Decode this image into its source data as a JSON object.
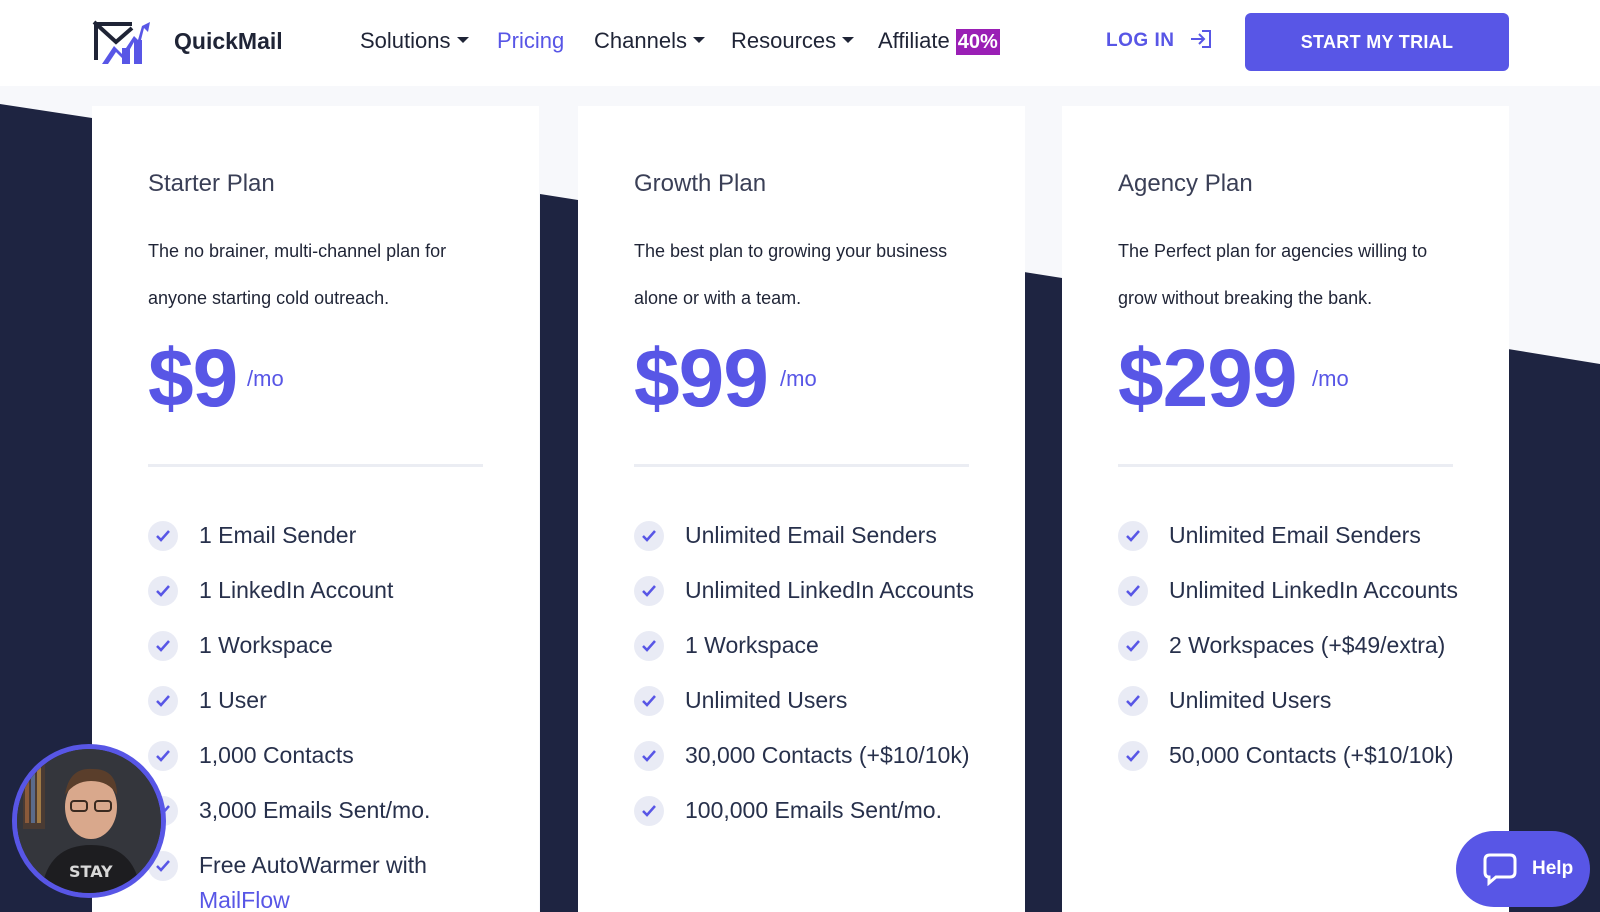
{
  "header": {
    "brand": "QuickMail",
    "nav": [
      {
        "label": "Solutions",
        "dropdown": true
      },
      {
        "label": "Pricing",
        "dropdown": false,
        "active": true
      },
      {
        "label": "Channels",
        "dropdown": true
      },
      {
        "label": "Resources",
        "dropdown": true
      },
      {
        "label": "Affiliate",
        "dropdown": false,
        "badge": "40%"
      }
    ],
    "login_label": "LOG IN",
    "trial_label": "START MY TRIAL"
  },
  "plans": [
    {
      "name": "Starter Plan",
      "description": "The no brainer, multi-channel plan for anyone starting cold outreach.",
      "price": "$9",
      "unit": "/mo",
      "features": [
        "1 Email Sender",
        "1 LinkedIn Account",
        "1 Workspace",
        "1 User",
        "1,000 Contacts",
        "3,000 Emails Sent/mo.",
        "Free AutoWarmer with"
      ],
      "feature_link": "MailFlow"
    },
    {
      "name": "Growth Plan",
      "description": "The best plan to growing your business alone or with a team.",
      "price": "$99",
      "unit": "/mo",
      "features": [
        "Unlimited Email Senders",
        "Unlimited LinkedIn Accounts",
        "1 Workspace",
        "Unlimited Users",
        "30,000 Contacts (+$10/10k)",
        "100,000 Emails Sent/mo."
      ]
    },
    {
      "name": "Agency Plan",
      "description": "The Perfect plan for agencies willing to grow without breaking the bank.",
      "price": "$299",
      "unit": "/mo",
      "features": [
        "Unlimited Email Senders",
        "Unlimited LinkedIn Accounts",
        "2 Workspaces (+$49/extra)",
        "Unlimited Users",
        "50,000 Contacts (+$10/10k)"
      ]
    }
  ],
  "help_label": "Help",
  "avatar_shirt_text": "STAY",
  "colors": {
    "accent": "#5856e6",
    "dark_band": "#1e2441",
    "affiliate_badge": "#9a1fb5"
  }
}
